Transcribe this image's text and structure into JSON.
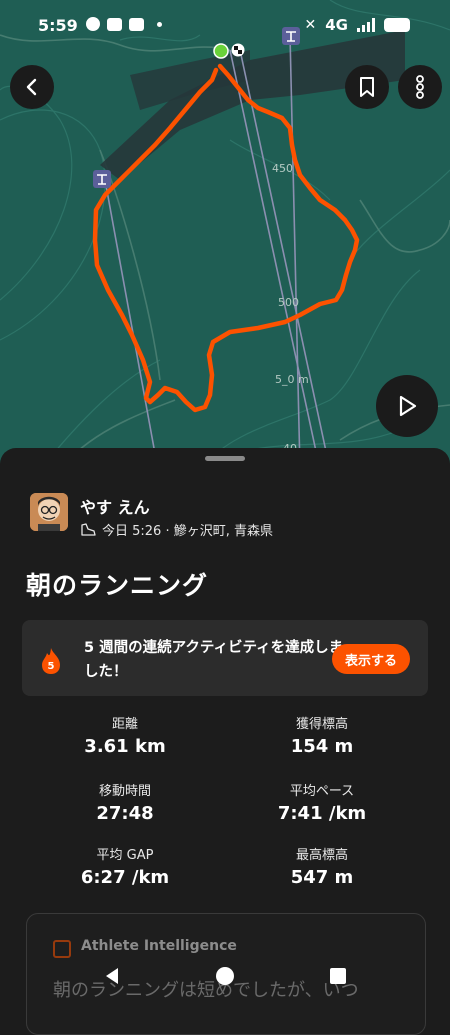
{
  "status_bar": {
    "time": "5:59",
    "network": "4G"
  },
  "map": {
    "contour_labels": [
      "450",
      "500",
      "5_0 m",
      "40"
    ]
  },
  "activity": {
    "user_name": "やす えん",
    "meta": "今日 5:26 · 鰺ヶ沢町, 青森県",
    "title": "朝のランニング"
  },
  "streak": {
    "count": "5",
    "message": "5 週間の連続アクティビティを達成しました！",
    "button_label": "表示する"
  },
  "stats": [
    {
      "label": "距離",
      "value": "3.61 km"
    },
    {
      "label": "獲得標高",
      "value": "154 m"
    },
    {
      "label": "移動時間",
      "value": "27:48"
    },
    {
      "label": "平均ペース",
      "value": "7:41 /km"
    },
    {
      "label": "平均 GAP",
      "value": "6:27 /km"
    },
    {
      "label": "最高標高",
      "value": "547 m"
    }
  ],
  "athlete_intelligence": {
    "title": "Athlete Intelligence",
    "text": "朝のランニングは短めでしたが、いつ"
  },
  "colors": {
    "accent": "#fc5200",
    "map_bg": "#1f5e54",
    "sheet_bg": "#1c1c1c"
  },
  "icons": [
    "back-arrow-icon",
    "bookmark-icon",
    "more-vertical-icon",
    "play-icon",
    "shoe-icon",
    "flame-icon",
    "lift-icon",
    "start-marker-icon",
    "finish-flag-icon"
  ]
}
